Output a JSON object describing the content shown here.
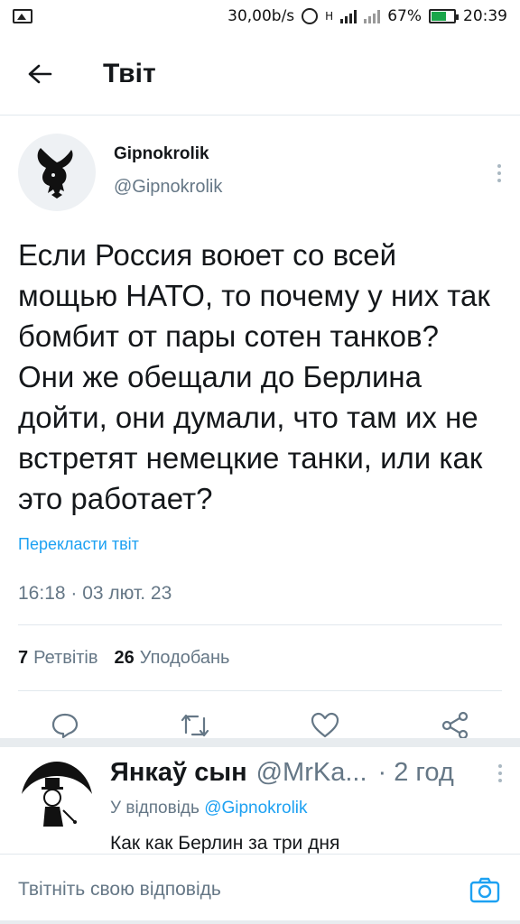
{
  "status_bar": {
    "speed": "30,00b/s",
    "network": "H",
    "battery": "67%",
    "battery_level": 0.67,
    "time": "20:39"
  },
  "header": {
    "title": "Твіт",
    "back_icon": "arrow-left-icon"
  },
  "tweet": {
    "author_name": "Gipnokrolik",
    "author_handle": "@Gipnokrolik",
    "text": "Если Россия воюет со всей мощью НАТО, то почему у них так бомбит от пары сотен танков? Они же обещали до Берлина дойти, они думали, что там их не встретят немецкие танки, или как это работает?",
    "translate_label": "Перекласти твіт",
    "timestamp": "16:18 · 03 лют. 23",
    "retweets_count": "7",
    "retweets_label": "Ретвітів",
    "likes_count": "26",
    "likes_label": "Уподобань",
    "actions": [
      "reply-icon",
      "retweet-icon",
      "like-icon",
      "share-icon"
    ]
  },
  "reply": {
    "name": "Янкаў сын",
    "handle": "@MrKa...",
    "time": "· 2 год",
    "reply_to_label": "У відповідь",
    "reply_to_handle": "@Gipnokrolik",
    "text": "Как как Берлин за три дня"
  },
  "composer": {
    "placeholder": "Твітніть свою відповідь",
    "camera_icon": "camera-icon"
  },
  "colors": {
    "accent": "#1da1f2",
    "secondary_text": "#657786",
    "battery": "#1aa64a"
  }
}
